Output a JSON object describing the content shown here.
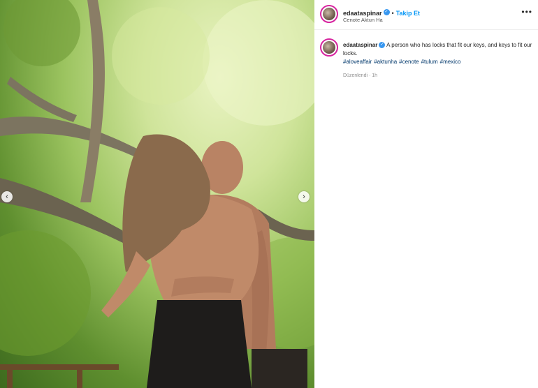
{
  "post": {
    "username": "edaataspinar",
    "follow_label": "Takip Et",
    "separator": "•",
    "location": "Cenote Aktun Ha",
    "more_label": "•••"
  },
  "caption": {
    "username": "edaataspinar",
    "text": "A person who has locks that fit our keys, and keys to fit our locks.",
    "hashtags": [
      "#aloveaffair",
      "#aktunha",
      "#cenote",
      "#tulum",
      "#mexico"
    ],
    "edited": "Düzenlendi · 1h"
  },
  "media": {
    "prev_label": "‹",
    "next_label": "›"
  },
  "colors": {
    "accent": "#0095f6",
    "hashtag": "#00376b",
    "verified": "#3897f0",
    "avatar_ring": "#d6249f"
  },
  "icons": [
    "verified-badge-icon",
    "more-options-icon",
    "chevron-left-icon",
    "chevron-right-icon"
  ]
}
